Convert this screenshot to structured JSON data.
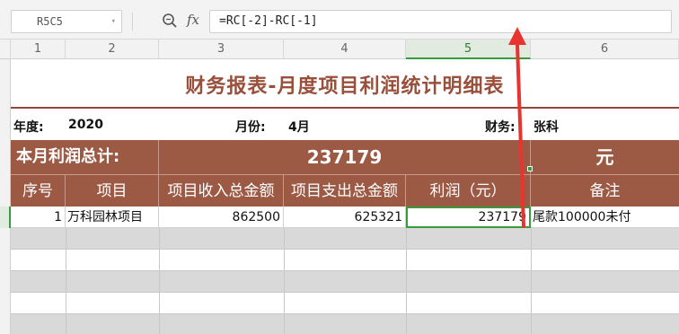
{
  "formula_bar": {
    "name_box": "R5C5",
    "fx_label": "fx",
    "formula": "=RC[-2]-RC[-1]"
  },
  "columns": [
    "1",
    "2",
    "3",
    "4",
    "5",
    "6"
  ],
  "active_column": "5",
  "sheet": {
    "title": "财务报表-月度项目利润统计明细表",
    "info": {
      "year_label": "年度:",
      "year_value": "2020",
      "month_label": "月份:",
      "month_value": "4月",
      "finance_label": "财务:",
      "finance_value": "张科"
    },
    "total": {
      "label": "本月利润总计:",
      "value": "237179",
      "unit": "元"
    },
    "headers": [
      "序号",
      "项目",
      "项目收入总金额",
      "项目支出总金额",
      "利润（元）",
      "备注"
    ],
    "rows": [
      {
        "no": "1",
        "project": "万科园林项目",
        "income": "862500",
        "expense": "625321",
        "profit": "237179",
        "note": "尾款100000未付"
      }
    ]
  },
  "colors": {
    "title": "#9a4f3a",
    "header_bg": "#9c5a45",
    "selection": "#3a9a3e",
    "annotation_arrow": "#e8332f"
  }
}
